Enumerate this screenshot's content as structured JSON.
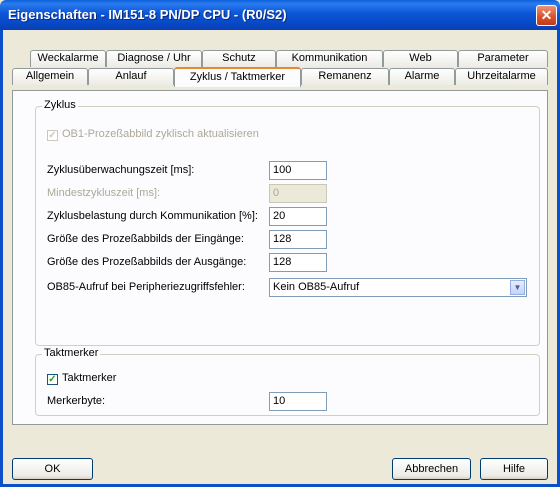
{
  "window": {
    "title": "Eigenschaften - IM151-8 PN/DP CPU - (R0/S2)",
    "close_glyph": "✕"
  },
  "tabs": {
    "row1": [
      "Weckalarme",
      "Diagnose / Uhr",
      "Schutz",
      "Kommunikation",
      "Web",
      "Parameter"
    ],
    "row2": [
      "Allgemein",
      "Anlauf",
      "Zyklus / Taktmerker",
      "Remanenz",
      "Alarme",
      "Uhrzeitalarme"
    ],
    "active": "Zyklus / Taktmerker"
  },
  "zyklus": {
    "group_label": "Zyklus",
    "ob1_checkbox_label": "OB1-Prozeßabbild zyklisch aktualisieren",
    "ob1_checked": true,
    "fields": [
      {
        "label": "Zyklusüberwachungszeit [ms]:",
        "value": "100",
        "enabled": true
      },
      {
        "label": "Mindestzykluszeit [ms]:",
        "value": "0",
        "enabled": false
      },
      {
        "label": "Zyklusbelastung durch Kommunikation [%]:",
        "value": "20",
        "enabled": true
      },
      {
        "label": "Größe des Prozeßabbilds der Eingänge:",
        "value": "128",
        "enabled": true
      },
      {
        "label": "Größe des Prozeßabbilds der Ausgänge:",
        "value": "128",
        "enabled": true
      }
    ],
    "ob85": {
      "label": "OB85-Aufruf bei Peripheriezugriffsfehler:",
      "value": "Kein OB85-Aufruf"
    }
  },
  "taktmerker": {
    "group_label": "Taktmerker",
    "checkbox_label": "Taktmerker",
    "checked": true,
    "merkerbyte_label": "Merkerbyte:",
    "merkerbyte_value": "10"
  },
  "buttons": {
    "ok": "OK",
    "cancel": "Abbrechen",
    "help": "Hilfe"
  }
}
